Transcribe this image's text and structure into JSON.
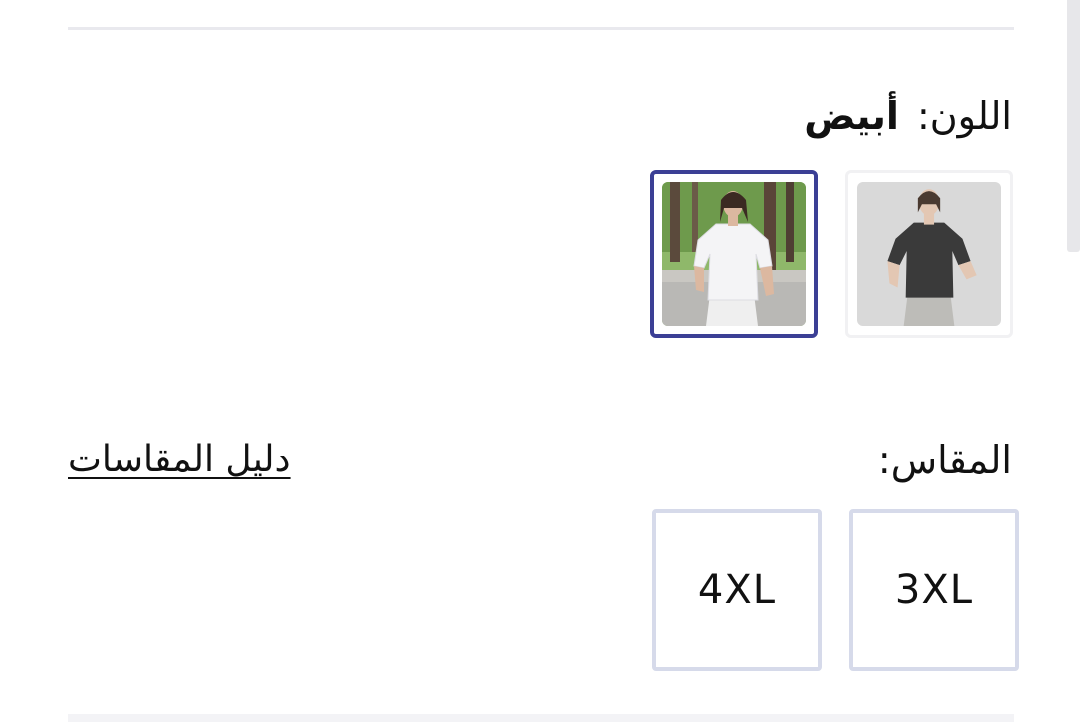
{
  "color": {
    "label": "اللون:",
    "selected_value": "أبيض",
    "options": [
      {
        "name": "black-shirt",
        "selected": false
      },
      {
        "name": "white-shirt",
        "selected": true
      }
    ],
    "selected_border_color": "#3b3f95"
  },
  "size": {
    "label": "المقاس:",
    "guide_link": "دليل المقاسات",
    "options": [
      {
        "label": "3XL"
      },
      {
        "label": "4XL"
      }
    ],
    "option_border_color": "#d6daea"
  }
}
